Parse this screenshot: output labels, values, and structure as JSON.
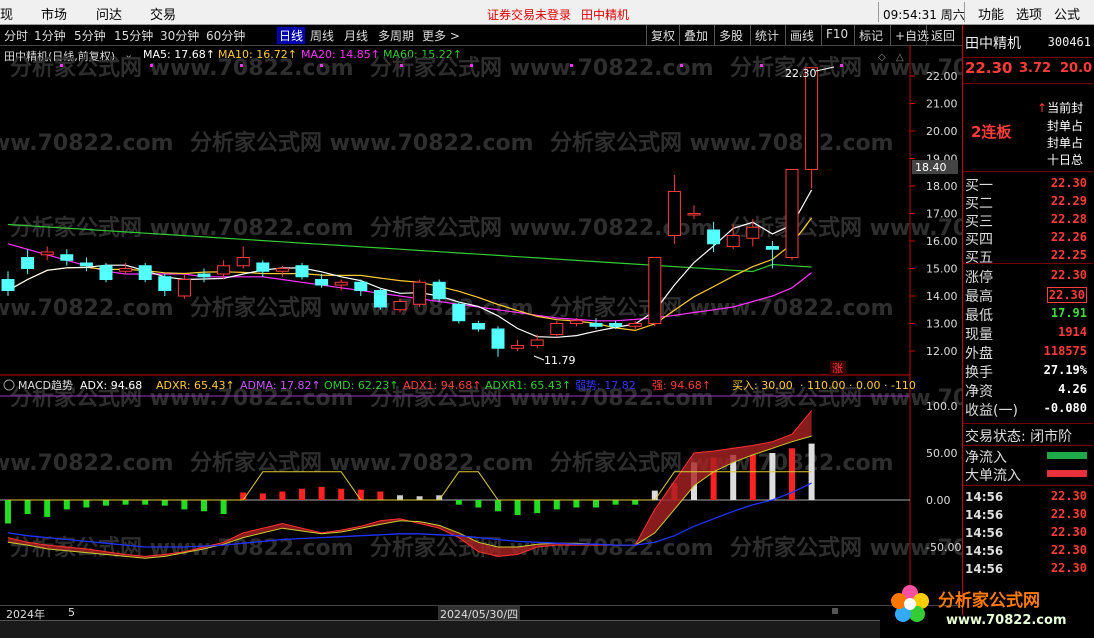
{
  "menu": {
    "items": [
      "现",
      "市场",
      "问达",
      "交易"
    ],
    "alert": "证券交易未登录",
    "stock_title": "田中精机",
    "clock": "09:54:31 周六",
    "right_items": [
      "功能",
      "选项",
      "公式"
    ]
  },
  "toolbar": {
    "periods": [
      "分时",
      "1分钟",
      "5分钟",
      "15分钟",
      "30分钟",
      "60分钟",
      "日线",
      "周线",
      "月线",
      "多周期",
      "更多 >"
    ],
    "active_period": "日线",
    "tools": [
      "复权",
      "叠加",
      "多股",
      "统计",
      "画线",
      "F10",
      "标记",
      "+自选",
      "返回"
    ]
  },
  "price_header": {
    "stock": "田中精机(日线,前复权)",
    "ma5": "MA5: 17.68↑",
    "ma10": "MA10: 16.72↑",
    "ma20": "MA20: 14.85↑",
    "ma60": "MA60: 15.22↑"
  },
  "indicator_header": {
    "name": "MACD趋势",
    "adx": "ADX: 94.68",
    "adxr": "ADXR: 65.43↑",
    "adma": "ADMA: 17.82↑",
    "omd": "OMD: 62.23↑",
    "adx1": "ADX1: 94.68↑",
    "adxr1": "ADXR1: 65.43↑",
    "weak": "弱势: 17.82",
    "strong": "强: 94.68↑",
    "buy": "买入: 30.00",
    "tail": "· 110.00 · 0.00 · -110"
  },
  "price_axis": [
    "22.00",
    "21.00",
    "20.00",
    "19.00",
    "18.00",
    "17.00",
    "16.00",
    "15.00",
    "14.00",
    "13.00",
    "12.00"
  ],
  "price_marker": "18.40",
  "high_label": "22.30",
  "low_label": "11.79",
  "limit_badge": "涨",
  "indicator_axis": [
    "100.0",
    "50.00",
    "0.00",
    "-50.00"
  ],
  "date_axis": {
    "year": "2024年",
    "month": "5",
    "cursor_date": "2024/05/30/四"
  },
  "quote": {
    "name": "田中精机",
    "code": "300461",
    "price": "22.30",
    "change": "3.72",
    "pct": "20.0",
    "streak": "2连板",
    "info_lines": [
      "当前封",
      "封单占",
      "封单占",
      "十日总"
    ],
    "book": [
      {
        "label": "买一",
        "value": "22.30"
      },
      {
        "label": "买二",
        "value": "22.29"
      },
      {
        "label": "买三",
        "value": "22.28"
      },
      {
        "label": "买四",
        "value": "22.26"
      },
      {
        "label": "买五",
        "value": "22.25"
      }
    ],
    "stats": [
      {
        "label": "涨停",
        "value": "22.30",
        "color": "red"
      },
      {
        "label": "最高",
        "value": "22.30",
        "color": "red"
      },
      {
        "label": "最低",
        "value": "17.91",
        "color": "green"
      },
      {
        "label": "现量",
        "value": "1914",
        "color": "red"
      },
      {
        "label": "外盘",
        "value": "118575",
        "color": "red"
      },
      {
        "label": "换手",
        "value": "27.19%",
        "color": "white"
      },
      {
        "label": "净资",
        "value": "4.26",
        "color": "white"
      },
      {
        "label": "收益(一)",
        "value": "-0.080",
        "color": "white"
      }
    ],
    "trade_state": "交易状态: 闭市阶",
    "flows": [
      {
        "label": "净流入",
        "color": "#1fa84a"
      },
      {
        "label": "大单流入",
        "color": "#e8313d"
      }
    ],
    "ticks": [
      {
        "time": "14:56",
        "price": "22.30"
      },
      {
        "time": "14:56",
        "price": "22.30"
      },
      {
        "time": "14:56",
        "price": "22.30"
      },
      {
        "time": "14:56",
        "price": "22.30"
      },
      {
        "time": "14:56",
        "price": "22.30"
      }
    ]
  },
  "watermark": "分析家公式网 www.70822.com",
  "logo": {
    "text": "分析家公式网",
    "url": "www.70822.com"
  },
  "colors": {
    "up": "#ff3b3b",
    "down": "#54ffff",
    "ma5": "#ffffff",
    "ma10": "#ffcc33",
    "ma20": "#ff33ff",
    "ma60": "#33cc33"
  }
}
